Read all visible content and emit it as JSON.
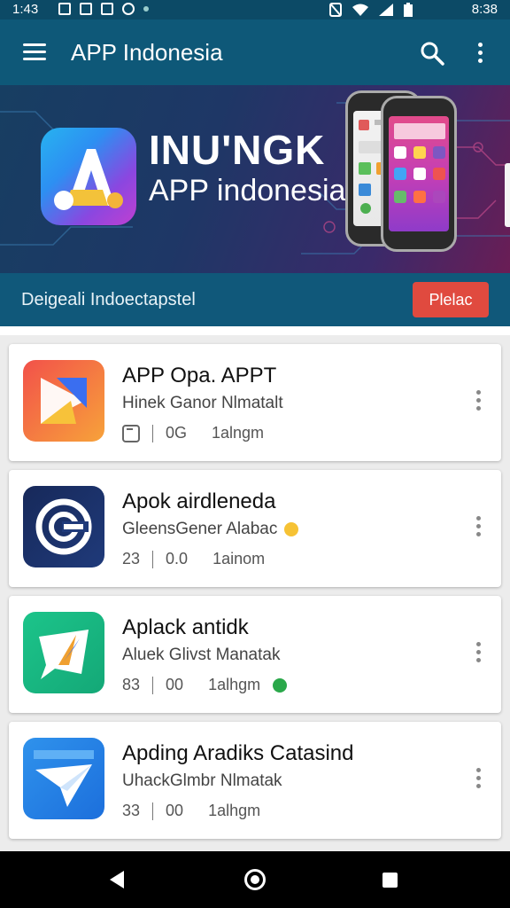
{
  "status_bar": {
    "time_left": "1:43",
    "time_right": "8:38"
  },
  "app_bar": {
    "title": "APP Indonesia",
    "menu_icon": "hamburger-menu-icon",
    "search_icon": "search-icon",
    "overflow_icon": "more-vert-icon"
  },
  "banner": {
    "headline": "INU'NGK",
    "subheadline": "APP indonesia"
  },
  "strip": {
    "text": "Deigeali Indoectapstel",
    "button_label": "Plelac",
    "button_color": "#e04a3f"
  },
  "apps": [
    {
      "name": "APP Opa. APPT",
      "developer": "Hinek Ganor Nlmatalt",
      "size": "0G",
      "category": "1alngm",
      "rating_icon": "download-box-icon",
      "rating": "",
      "icon_colors": [
        "#f2514a",
        "#f7a23a"
      ],
      "badge_color": ""
    },
    {
      "name": "Apok airdleneda",
      "developer": "GleensGener Alabac",
      "rating": "23",
      "size": "0.0",
      "category": "1ainom",
      "icon_colors": [
        "#17295a",
        "#1f3a7a"
      ],
      "badge_color": "#f6c234"
    },
    {
      "name": "Aplack antidk",
      "developer": "Aluek Glivst Manatak",
      "rating": "83",
      "size": "00",
      "category": "1alhgm",
      "icon_colors": [
        "#1cc48a",
        "#22b37d"
      ],
      "badge_color": "#2aa84a"
    },
    {
      "name": "Apding Aradiks Catasind",
      "developer": "UhackGlmbr Nlmatak",
      "rating": "33",
      "size": "00",
      "category": "1alhgm",
      "icon_colors": [
        "#2f92ec",
        "#1c6fdc"
      ],
      "badge_color": ""
    }
  ]
}
